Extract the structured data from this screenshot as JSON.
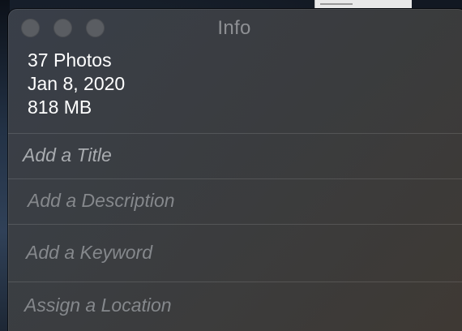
{
  "window": {
    "title": "Info"
  },
  "summary": {
    "photo_count": "37 Photos",
    "date": "Jan 8, 2020",
    "size": "818 MB"
  },
  "fields": {
    "title_placeholder": "Add a Title",
    "description_placeholder": "Add a Description",
    "keyword_placeholder": "Add a Keyword",
    "location_placeholder": "Assign a Location"
  },
  "colors": {
    "window_background": "#3c3e42",
    "traffic_light_inactive": "#5a5d62",
    "title_text": "#8e9094",
    "primary_text": "#ffffff",
    "placeholder_text": "#85888c",
    "divider": "#4f5256"
  },
  "icons": {
    "traffic_lights": [
      "close-button",
      "minimize-button",
      "zoom-button"
    ]
  }
}
